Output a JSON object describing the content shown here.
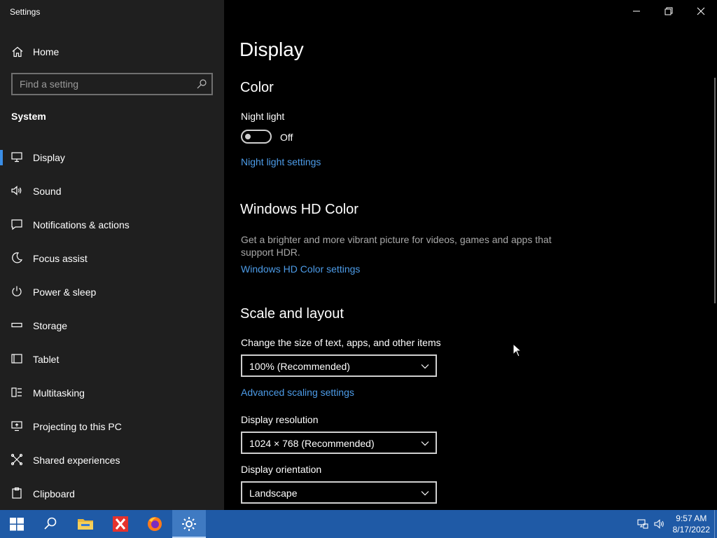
{
  "window": {
    "title": "Settings"
  },
  "sidebar": {
    "home_label": "Home",
    "search_placeholder": "Find a setting",
    "section": "System",
    "items": [
      {
        "label": "Display",
        "icon": "monitor-icon",
        "active": true
      },
      {
        "label": "Sound",
        "icon": "speaker-icon"
      },
      {
        "label": "Notifications & actions",
        "icon": "notification-icon"
      },
      {
        "label": "Focus assist",
        "icon": "moon-icon"
      },
      {
        "label": "Power & sleep",
        "icon": "power-icon"
      },
      {
        "label": "Storage",
        "icon": "storage-icon"
      },
      {
        "label": "Tablet",
        "icon": "tablet-icon"
      },
      {
        "label": "Multitasking",
        "icon": "multitasking-icon"
      },
      {
        "label": "Projecting to this PC",
        "icon": "projecting-icon"
      },
      {
        "label": "Shared experiences",
        "icon": "shared-experiences-icon"
      },
      {
        "label": "Clipboard",
        "icon": "clipboard-icon"
      }
    ]
  },
  "main": {
    "page_title": "Display",
    "color": {
      "heading": "Color",
      "night_light_label": "Night light",
      "night_light_state": "Off",
      "night_light_settings_link": "Night light settings"
    },
    "hd_color": {
      "heading": "Windows HD Color",
      "description": "Get a brighter and more vibrant picture for videos, games and apps that support HDR.",
      "settings_link": "Windows HD Color settings"
    },
    "scale_layout": {
      "heading": "Scale and layout",
      "size_label": "Change the size of text, apps, and other items",
      "size_value": "100% (Recommended)",
      "advanced_link": "Advanced scaling settings",
      "resolution_label": "Display resolution",
      "resolution_value": "1024 × 768 (Recommended)",
      "orientation_label": "Display orientation",
      "orientation_value": "Landscape"
    }
  },
  "taskbar": {
    "buttons": [
      "start-icon",
      "search-icon",
      "file-explorer-icon",
      "xampp-icon",
      "firefox-icon",
      "settings-icon"
    ],
    "clock_time": "9:57 AM",
    "clock_date": "8/17/2022"
  },
  "colors": {
    "sidebar_bg": "#1f1f1f",
    "accent_link": "#4d9ce8",
    "active_indicator": "#3a8ee6",
    "taskbar_bg": "#1f5aa6"
  }
}
